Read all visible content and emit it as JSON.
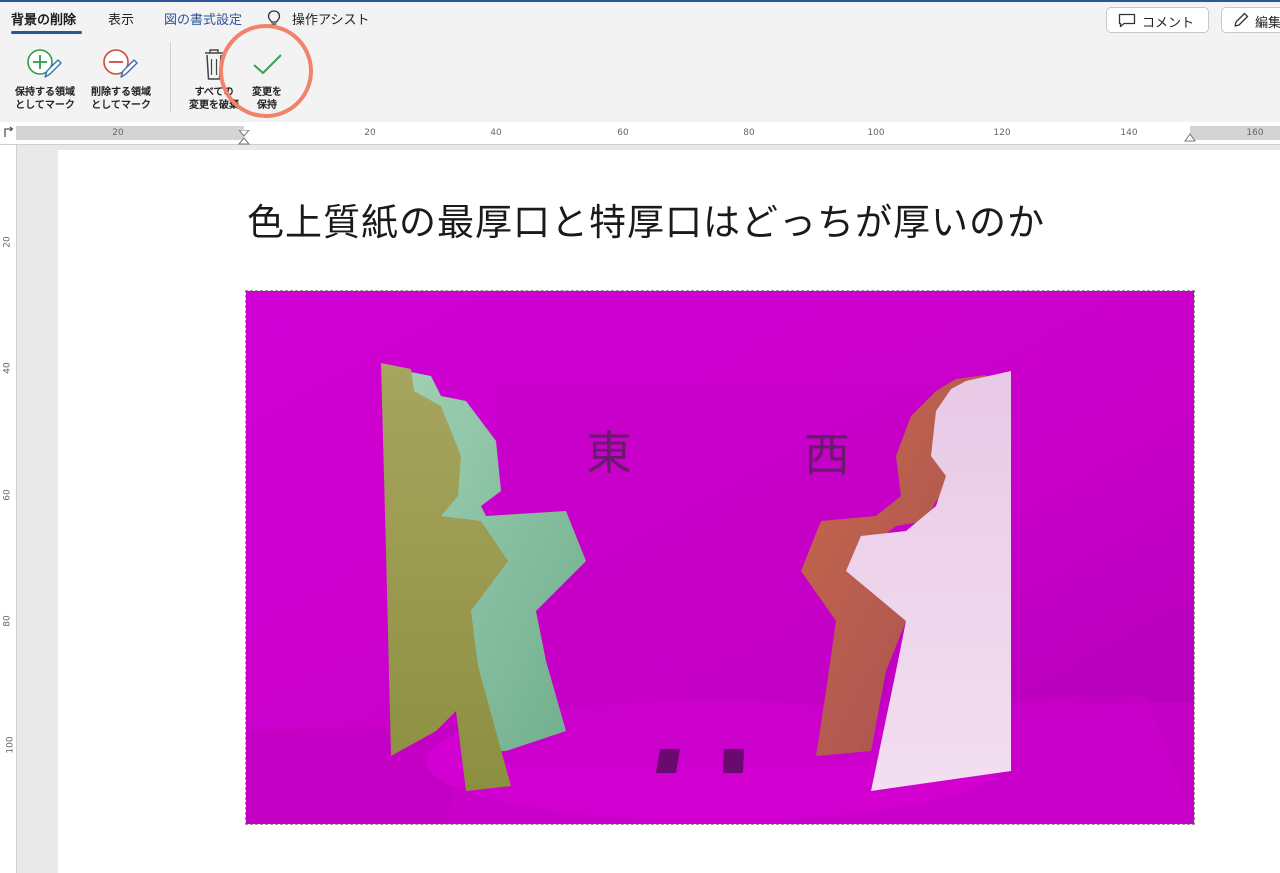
{
  "tabs": {
    "remove_background": "背景の削除",
    "view": "表示",
    "picture_format": "図の書式設定",
    "tell_me": "操作アシスト"
  },
  "top_buttons": {
    "comment": "コメント",
    "edit": "編集"
  },
  "ribbon": {
    "mark_keep": "保持する領域\nとしてマーク",
    "mark_remove": "削除する領域\nとしてマーク",
    "discard_all": "すべての\n変更を破棄",
    "keep_changes": "変更を\n保持"
  },
  "ruler": {
    "h_ticks": [
      "20",
      "20",
      "40",
      "60",
      "80",
      "100",
      "120",
      "140",
      "160"
    ],
    "v_ticks": [
      "20",
      "40",
      "60",
      "80",
      "100"
    ]
  },
  "document": {
    "title": "色上質紙の最厚口と特厚口はどっちが厚いのか",
    "left_label": "東",
    "right_label": "西"
  },
  "colors": {
    "accent": "#2b579a",
    "highlight_ring": "#f0836a",
    "removed_area": "#cc00cc"
  }
}
